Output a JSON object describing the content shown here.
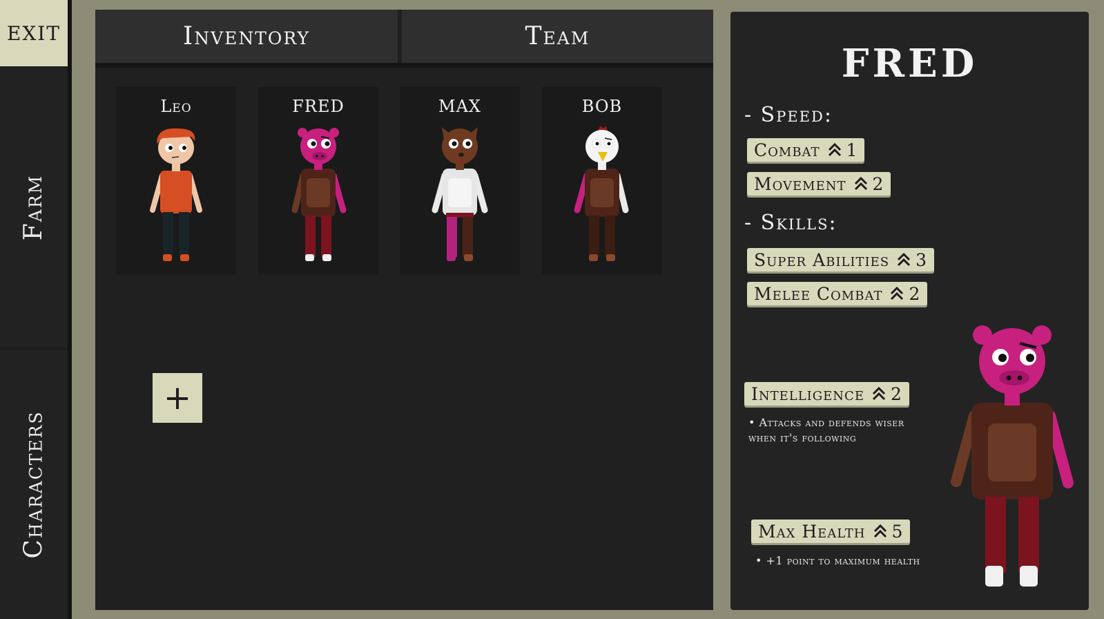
{
  "sidebar": {
    "exit_label": "EXIT",
    "farm_label": "Farm",
    "characters_label": "Characters"
  },
  "tabs": {
    "inventory": "Inventory",
    "team": "Team"
  },
  "inventory": {
    "characters": [
      {
        "name": "Leo"
      },
      {
        "name": "FRED"
      },
      {
        "name": "MAX"
      },
      {
        "name": "BOB"
      }
    ],
    "add_button_label": "+"
  },
  "detail": {
    "name": "FRED",
    "speed_label": "- Speed:",
    "skills_label": "- Skills:",
    "stats": {
      "combat": {
        "label": "Combat",
        "value": "1"
      },
      "movement": {
        "label": "Movement",
        "value": "2"
      },
      "super_abilities": {
        "label": "Super Abilities",
        "value": "3"
      },
      "melee_combat": {
        "label": "Melee Combat",
        "value": "2"
      },
      "intelligence": {
        "label": "Intelligence",
        "value": "2",
        "description": "• Attacks and defends wiser when it's following"
      },
      "max_health": {
        "label": "Max Health",
        "value": "5",
        "description": "• +1 point to maximum health"
      }
    }
  },
  "colors": {
    "background": "#8d8c76",
    "panel": "#232323",
    "badge": "#d8d9bb",
    "pig_pink": "#c8207f"
  }
}
